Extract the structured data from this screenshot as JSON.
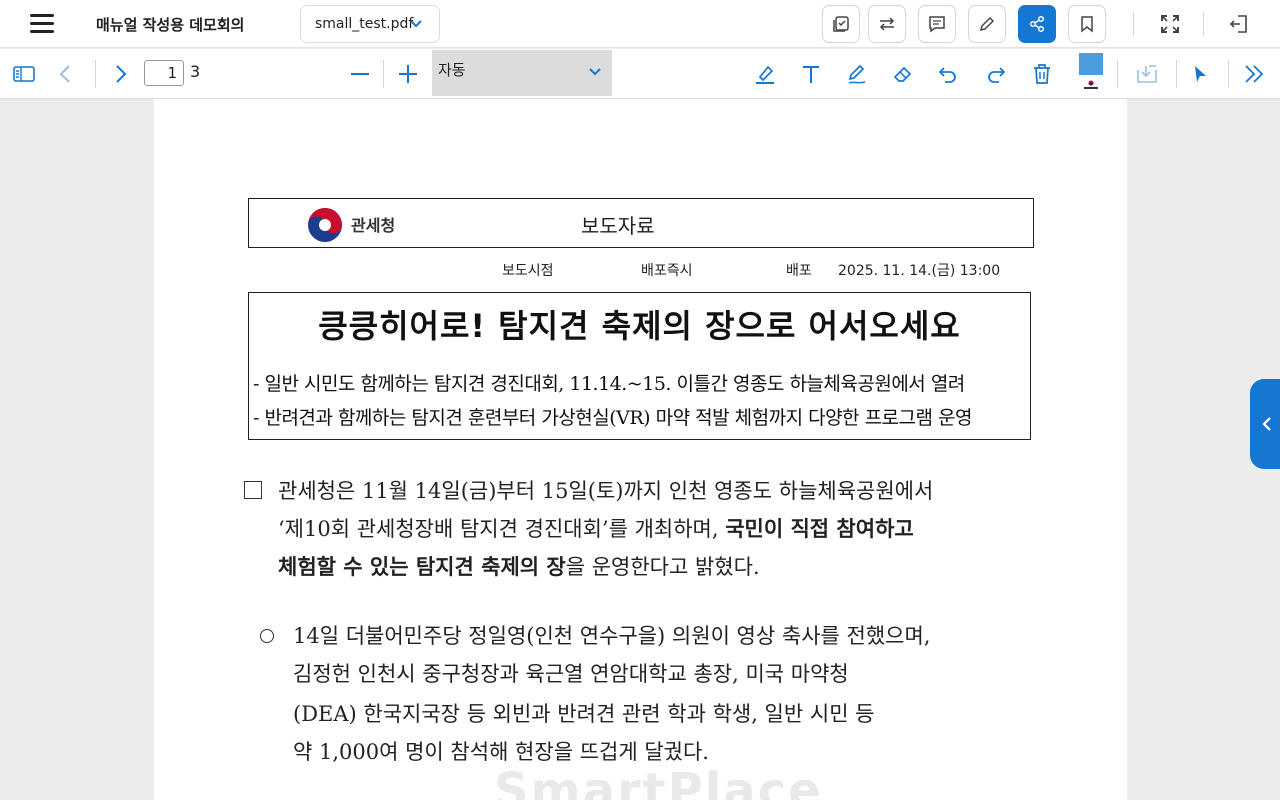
{
  "header": {
    "app_title": "매뉴얼 작성용 데모회의",
    "file_name": "small_test.pdf"
  },
  "toolbar": {
    "current_page": "1",
    "total_pages": "3",
    "zoom_label": "자동",
    "annotation_color": "#4a9ee0"
  },
  "colors": {
    "accent": "#1677d2",
    "icon": "#444444",
    "icon_blue": "#1677d2"
  },
  "document": {
    "org_name": "관세청",
    "doc_type": "보도자료",
    "meta_release_time_label": "보도시점",
    "meta_release_time_value": "배포즉시",
    "meta_dist_label": "배포",
    "meta_dist_value": "2025. 11. 14.(금) 13:00",
    "headline": "킁킁히어로! 탐지견 축제의 장으로 어서오세요",
    "sub1": "- 일반 시민도 함께하는 탐지견 경진대회, 11.14.~15. 이틀간 영종도 하늘체육공원에서 열려",
    "sub2": "- 반려견과 함께하는 탐지견 훈련부터 가상현실(VR) 마약 적발 체험까지 다양한 프로그램 운영",
    "p1_line1": "관세청은 11월 14일(금)부터 15일(토)까지 인천 영종도 하늘체육공원에서",
    "p1_line2_a": "‘제10회 관세청장배 탐지견 경진대회’를 개최하며, ",
    "p1_line2_b": "국민이 직접 참여하고",
    "p1_line3_a": "체험할 수 있는 탐지견 축제의 장",
    "p1_line3_b": "을 운영한다고 밝혔다.",
    "p2_line1": "14일 더불어민주당 정일영(인천 연수구을) 의원이 영상 축사를 전했으며,",
    "p2_line2": "김정헌 인천시 중구청장과 육근열 연암대학교 총장, 미국 마약청",
    "p2_line3": "(DEA) 한국지국장 등 외빈과 반려견 관련 학과 학생, 일반 시민 등",
    "p2_line4": "약 1,000여 명이 참석해 현장을 뜨겁게 달궜다.",
    "watermark": "SmartPlace"
  }
}
